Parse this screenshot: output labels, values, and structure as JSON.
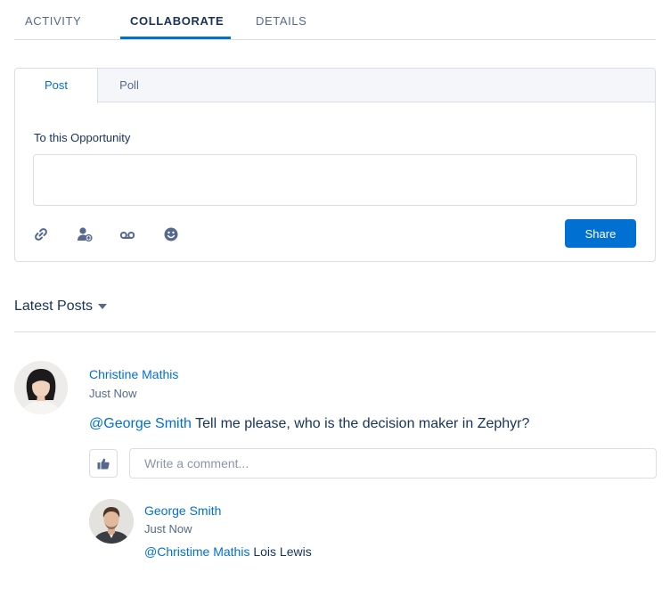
{
  "tabs": [
    {
      "label": "ACTIVITY",
      "active": false
    },
    {
      "label": "COLLABORATE",
      "active": true
    },
    {
      "label": "DETAILS",
      "active": false
    }
  ],
  "publisher": {
    "tabs": [
      {
        "label": "Post",
        "active": true
      },
      {
        "label": "Poll",
        "active": false
      }
    ],
    "to_label": "To this Opportunity",
    "input_value": "",
    "toolbar_icons": [
      "link-icon",
      "add-user-icon",
      "voicemail-icon",
      "smiley-icon"
    ],
    "share_label": "Share"
  },
  "feed": {
    "header": "Latest Posts",
    "post": {
      "author": "Christine Mathis",
      "timestamp": "Just Now",
      "mention": "@George Smith",
      "text": " Tell me please, who is the decision maker in Zephyr?",
      "comment_placeholder": "Write a comment...",
      "reply": {
        "author": "George Smith",
        "timestamp": "Just Now",
        "mention": "@Christime Mathis",
        "text": " Lois Lewis"
      }
    }
  },
  "colors": {
    "brand": "#0070d2",
    "text": "#16325c",
    "muted": "#54698d",
    "border": "#d8dde6"
  }
}
